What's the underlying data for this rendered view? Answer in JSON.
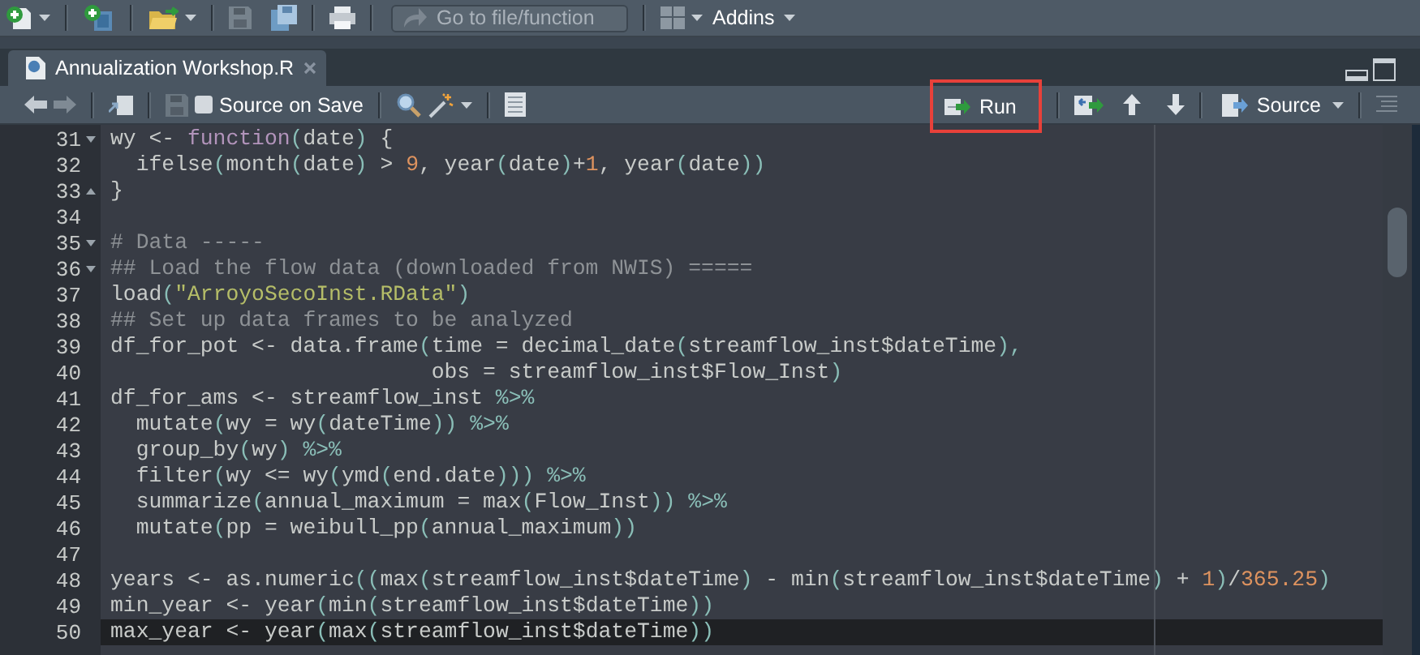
{
  "toolbar": {
    "goto": {
      "placeholder": "Go to file/function"
    },
    "addins": {
      "label": "Addins"
    }
  },
  "tabs": [
    {
      "label": "Annualization Workshop.R",
      "selected": true
    }
  ],
  "editor_toolbar": {
    "source_on_save": {
      "label": "Source on Save",
      "checked": false
    },
    "run": {
      "label": "Run",
      "highlighted": true
    },
    "source": {
      "label": "Source"
    }
  },
  "lines": [
    {
      "number": "31",
      "fold_start": true,
      "fold_end": false,
      "current": false,
      "tokens": [
        {
          "kind": "plain",
          "text": "wy <- "
        },
        {
          "kind": "keyword",
          "text": "function"
        },
        {
          "kind": "paren",
          "text": "("
        },
        {
          "kind": "plain",
          "text": "date"
        },
        {
          "kind": "paren",
          "text": ")"
        },
        {
          "kind": "plain",
          "text": " {"
        }
      ]
    },
    {
      "number": "32",
      "fold_start": false,
      "fold_end": false,
      "current": false,
      "tokens": [
        {
          "kind": "plain",
          "text": "  ifelse"
        },
        {
          "kind": "paren",
          "text": "("
        },
        {
          "kind": "plain",
          "text": "month"
        },
        {
          "kind": "paren",
          "text": "("
        },
        {
          "kind": "plain",
          "text": "date"
        },
        {
          "kind": "paren",
          "text": ")"
        },
        {
          "kind": "plain",
          "text": " > "
        },
        {
          "kind": "number",
          "text": "9"
        },
        {
          "kind": "plain",
          "text": ", year"
        },
        {
          "kind": "paren",
          "text": "("
        },
        {
          "kind": "plain",
          "text": "date"
        },
        {
          "kind": "paren",
          "text": ")"
        },
        {
          "kind": "plain",
          "text": "+"
        },
        {
          "kind": "number",
          "text": "1"
        },
        {
          "kind": "plain",
          "text": ", year"
        },
        {
          "kind": "paren",
          "text": "("
        },
        {
          "kind": "plain",
          "text": "date"
        },
        {
          "kind": "paren",
          "text": "))"
        }
      ]
    },
    {
      "number": "33",
      "fold_start": false,
      "fold_end": true,
      "current": false,
      "tokens": [
        {
          "kind": "plain",
          "text": "}"
        }
      ]
    },
    {
      "number": "34",
      "fold_start": false,
      "fold_end": false,
      "current": false
    },
    {
      "number": "35",
      "fold_start": true,
      "fold_end": false,
      "current": false,
      "tokens": [
        {
          "kind": "comment",
          "text": "# Data -----"
        }
      ]
    },
    {
      "number": "36",
      "fold_start": true,
      "fold_end": false,
      "current": false,
      "tokens": [
        {
          "kind": "comment",
          "text": "## Load the flow data (downloaded from NWIS) ====="
        }
      ]
    },
    {
      "number": "37",
      "fold_start": false,
      "fold_end": false,
      "current": false,
      "tokens": [
        {
          "kind": "plain",
          "text": "load"
        },
        {
          "kind": "paren",
          "text": "("
        },
        {
          "kind": "string",
          "text": "\"ArroyoSecoInst.RData\""
        },
        {
          "kind": "paren",
          "text": ")"
        }
      ]
    },
    {
      "number": "38",
      "fold_start": false,
      "fold_end": false,
      "current": false,
      "tokens": [
        {
          "kind": "comment",
          "text": "## Set up data frames to be analyzed"
        }
      ]
    },
    {
      "number": "39",
      "fold_start": false,
      "fold_end": false,
      "current": false,
      "tokens": [
        {
          "kind": "plain",
          "text": "df_for_pot <- data.frame"
        },
        {
          "kind": "paren",
          "text": "("
        },
        {
          "kind": "plain",
          "text": "time = decimal_date"
        },
        {
          "kind": "paren",
          "text": "("
        },
        {
          "kind": "plain",
          "text": "streamflow_inst$dateTime"
        },
        {
          "kind": "paren",
          "text": "),"
        }
      ]
    },
    {
      "number": "40",
      "fold_start": false,
      "fold_end": false,
      "current": false,
      "tokens": [
        {
          "kind": "plain",
          "text": "                         obs = streamflow_inst$Flow_Inst"
        },
        {
          "kind": "paren",
          "text": ")"
        }
      ]
    },
    {
      "number": "41",
      "fold_start": false,
      "fold_end": false,
      "current": false,
      "tokens": [
        {
          "kind": "plain",
          "text": "df_for_ams <- streamflow_inst"
        },
        {
          "kind": "paren",
          "text": " %>%"
        }
      ]
    },
    {
      "number": "42",
      "fold_start": false,
      "fold_end": false,
      "current": false,
      "tokens": [
        {
          "kind": "plain",
          "text": "  mutate"
        },
        {
          "kind": "paren",
          "text": "("
        },
        {
          "kind": "plain",
          "text": "wy = wy"
        },
        {
          "kind": "paren",
          "text": "("
        },
        {
          "kind": "plain",
          "text": "dateTime"
        },
        {
          "kind": "paren",
          "text": ")) %>%"
        }
      ]
    },
    {
      "number": "43",
      "fold_start": false,
      "fold_end": false,
      "current": false,
      "tokens": [
        {
          "kind": "plain",
          "text": "  group_by"
        },
        {
          "kind": "paren",
          "text": "("
        },
        {
          "kind": "plain",
          "text": "wy"
        },
        {
          "kind": "paren",
          "text": ") %>%"
        }
      ]
    },
    {
      "number": "44",
      "fold_start": false,
      "fold_end": false,
      "current": false,
      "tokens": [
        {
          "kind": "plain",
          "text": "  filter"
        },
        {
          "kind": "paren",
          "text": "("
        },
        {
          "kind": "plain",
          "text": "wy <= wy"
        },
        {
          "kind": "paren",
          "text": "("
        },
        {
          "kind": "plain",
          "text": "ymd"
        },
        {
          "kind": "paren",
          "text": "("
        },
        {
          "kind": "plain",
          "text": "end.date"
        },
        {
          "kind": "paren",
          "text": "))) %>%"
        }
      ]
    },
    {
      "number": "45",
      "fold_start": false,
      "fold_end": false,
      "current": false,
      "tokens": [
        {
          "kind": "plain",
          "text": "  summarize"
        },
        {
          "kind": "paren",
          "text": "("
        },
        {
          "kind": "plain",
          "text": "annual_maximum = max"
        },
        {
          "kind": "paren",
          "text": "("
        },
        {
          "kind": "plain",
          "text": "Flow_Inst"
        },
        {
          "kind": "paren",
          "text": ")) %>%"
        }
      ]
    },
    {
      "number": "46",
      "fold_start": false,
      "fold_end": false,
      "current": false,
      "tokens": [
        {
          "kind": "plain",
          "text": "  mutate"
        },
        {
          "kind": "paren",
          "text": "("
        },
        {
          "kind": "plain",
          "text": "pp = weibull_pp"
        },
        {
          "kind": "paren",
          "text": "("
        },
        {
          "kind": "plain",
          "text": "annual_maximum"
        },
        {
          "kind": "paren",
          "text": "))"
        }
      ]
    },
    {
      "number": "47",
      "fold_start": false,
      "fold_end": false,
      "current": false
    },
    {
      "number": "48",
      "fold_start": false,
      "fold_end": false,
      "current": false,
      "tokens": [
        {
          "kind": "plain",
          "text": "years <- as.numeric"
        },
        {
          "kind": "paren",
          "text": "(("
        },
        {
          "kind": "plain",
          "text": "max"
        },
        {
          "kind": "paren",
          "text": "("
        },
        {
          "kind": "plain",
          "text": "streamflow_inst$dateTime"
        },
        {
          "kind": "paren",
          "text": ")"
        },
        {
          "kind": "plain",
          "text": " - min"
        },
        {
          "kind": "paren",
          "text": "("
        },
        {
          "kind": "plain",
          "text": "streamflow_inst$dateTime"
        },
        {
          "kind": "paren",
          "text": ")"
        },
        {
          "kind": "plain",
          "text": " + "
        },
        {
          "kind": "number",
          "text": "1"
        },
        {
          "kind": "paren",
          "text": ")"
        },
        {
          "kind": "plain",
          "text": "/"
        },
        {
          "kind": "number",
          "text": "365.25"
        },
        {
          "kind": "paren",
          "text": ")"
        }
      ]
    },
    {
      "number": "49",
      "fold_start": false,
      "fold_end": false,
      "current": false,
      "tokens": [
        {
          "kind": "plain",
          "text": "min_year <- year"
        },
        {
          "kind": "paren",
          "text": "("
        },
        {
          "kind": "plain",
          "text": "min"
        },
        {
          "kind": "paren",
          "text": "("
        },
        {
          "kind": "plain",
          "text": "streamflow_inst$dateTime"
        },
        {
          "kind": "paren",
          "text": "))"
        }
      ]
    },
    {
      "number": "50",
      "fold_start": false,
      "fold_end": false,
      "current": true,
      "tokens": [
        {
          "kind": "plain",
          "text": "max_year <- year"
        },
        {
          "kind": "paren",
          "text": "("
        },
        {
          "kind": "plain",
          "text": "max"
        },
        {
          "kind": "paren",
          "text": "("
        },
        {
          "kind": "plain",
          "text": "streamflow_inst$dateTime"
        },
        {
          "kind": "paren",
          "text": "))"
        }
      ]
    }
  ]
}
